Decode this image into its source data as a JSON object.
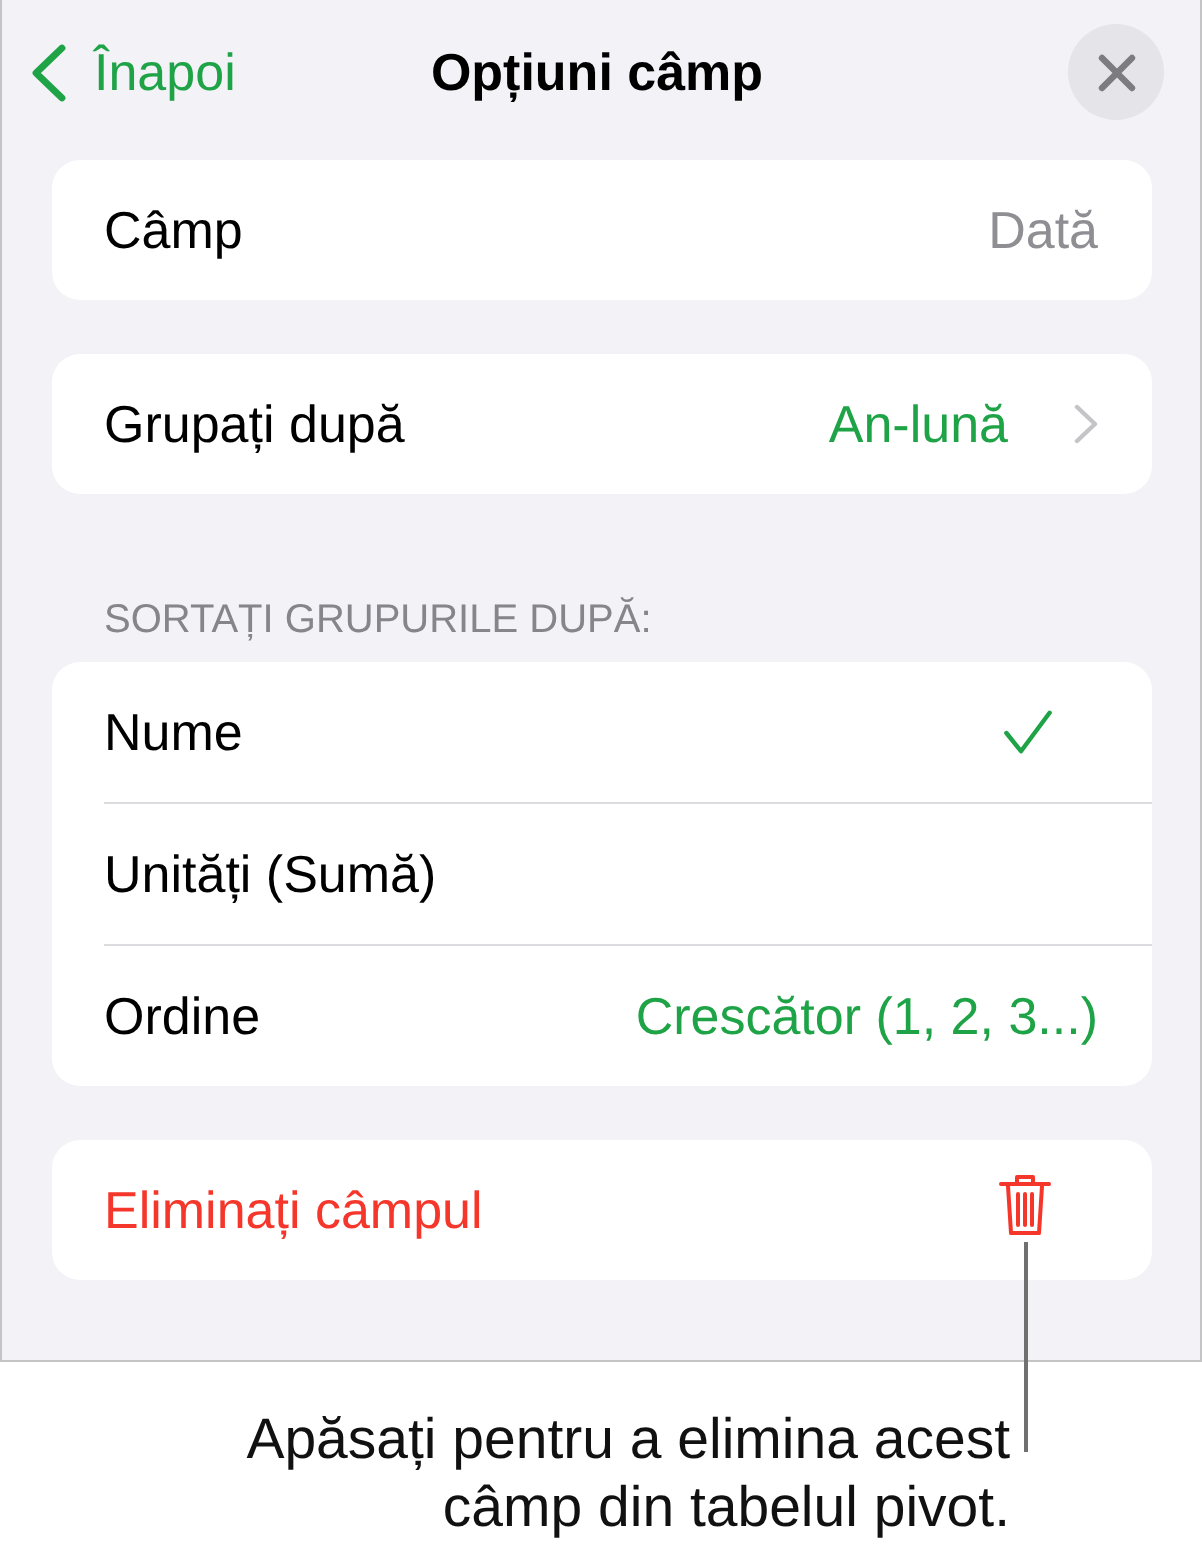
{
  "header": {
    "back": {
      "label": "Înapoi"
    },
    "title": "Opțiuni câmp"
  },
  "field_card": {
    "label": "Câmp",
    "value": "Dată"
  },
  "group_card": {
    "label": "Grupați după",
    "value": "An-lună"
  },
  "sort_section": {
    "heading": "SORTAȚI GRUPURILE DUPĂ:",
    "rows": [
      {
        "kind": "option",
        "label": "Nume",
        "selected": true
      },
      {
        "kind": "option",
        "label": "Unități (Sumă)",
        "selected": false
      },
      {
        "kind": "value",
        "label": "Ordine",
        "value": "Crescător (1, 2, 3...)"
      }
    ]
  },
  "delete_card": {
    "label": "Eliminați câmpul"
  },
  "callout": {
    "text": "Apăsați pentru a elimina acest câmp din tabelul pivot."
  }
}
